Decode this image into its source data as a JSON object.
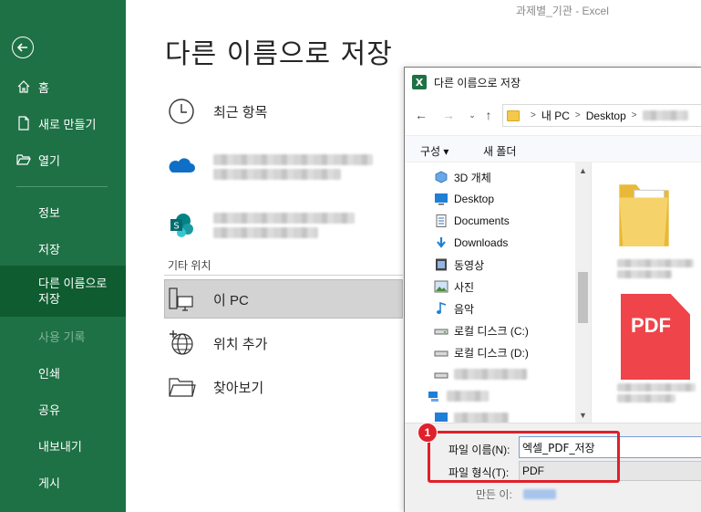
{
  "window": {
    "doc_title": "과제별_기관  -  Excel"
  },
  "sidebar": {
    "back_icon": "back-arrow-icon",
    "items": [
      {
        "label": "홈",
        "icon": "home-icon"
      },
      {
        "label": "새로 만들기",
        "icon": "new-document-icon"
      },
      {
        "label": "열기",
        "icon": "open-folder-icon"
      }
    ],
    "sub_items": [
      {
        "label": "정보"
      },
      {
        "label": "저장"
      },
      {
        "label": "다른 이름으로\n저장",
        "active": true
      },
      {
        "label": "사용 기록",
        "disabled": true
      },
      {
        "label": "인쇄"
      },
      {
        "label": "공유"
      },
      {
        "label": "내보내기"
      },
      {
        "label": "게시"
      }
    ],
    "active_line1": "다른 이름으로",
    "active_line2": "저장",
    "colors": {
      "bg": "#1e7145",
      "active": "#0e5c30"
    }
  },
  "main": {
    "page_title": "다른 이름으로 저장",
    "recent_label": "최근 항목",
    "other_locations_label": "기타 위치",
    "this_pc_label": "이 PC",
    "add_location_label": "위치 추가",
    "browse_label": "찾아보기"
  },
  "dialog": {
    "title": "다른 이름으로 저장",
    "app_icon": "X",
    "address": {
      "part1": "내 PC",
      "part2": "Desktop"
    },
    "toolbar": {
      "organize": "구성 ▾",
      "new_folder": "새 폴더"
    },
    "tree": [
      {
        "label": "3D 개체",
        "icon": "3d-objects-icon"
      },
      {
        "label": "Desktop",
        "icon": "desktop-icon"
      },
      {
        "label": "Documents",
        "icon": "documents-icon"
      },
      {
        "label": "Downloads",
        "icon": "downloads-icon"
      },
      {
        "label": "동영상",
        "icon": "video-icon"
      },
      {
        "label": "사진",
        "icon": "pictures-icon"
      },
      {
        "label": "음악",
        "icon": "music-icon"
      },
      {
        "label": "로컬 디스크 (C:)",
        "icon": "drive-icon"
      },
      {
        "label": "로컬 디스크 (D:)",
        "icon": "drive-icon"
      }
    ],
    "file_name_label": "파일 이름(N):",
    "file_name_value": "엑셀_PDF_저장",
    "file_type_label": "파일 형식(T):",
    "file_type_value": "PDF",
    "author_label": "만든 이:",
    "pdf_icon_text": "PDF"
  },
  "annotation": {
    "badge": "1",
    "color": "#e0202a"
  }
}
